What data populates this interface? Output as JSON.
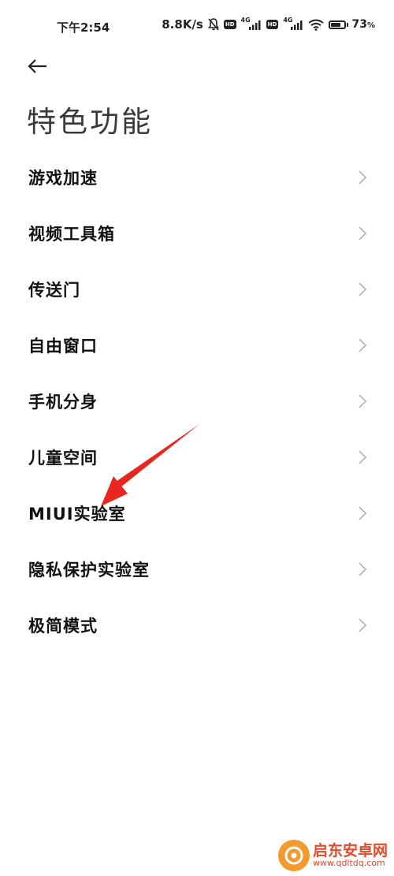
{
  "status_bar": {
    "time": "下午2:54",
    "net_speed": "8.8K/s",
    "sim1_network": "4G",
    "sim2_network": "4G",
    "hd_badge": "HD",
    "battery_percent_value": "73",
    "battery_percent_unit": "%",
    "battery_level": 0.73,
    "icons": [
      "mute-bell-icon",
      "hd-icon",
      "signal-icon",
      "hd-icon",
      "signal-icon",
      "wifi-icon",
      "battery-icon"
    ]
  },
  "header": {
    "back_icon": "back-arrow-icon",
    "title": "特色功能"
  },
  "menu": {
    "items": [
      {
        "label": "游戏加速"
      },
      {
        "label": "视频工具箱"
      },
      {
        "label": "传送门"
      },
      {
        "label": "自由窗口"
      },
      {
        "label": "手机分身"
      },
      {
        "label": "儿童空间"
      },
      {
        "label": "MIUI实验室"
      },
      {
        "label": "隐私保护实验室"
      },
      {
        "label": "极简模式"
      }
    ],
    "chevron_icon": "chevron-right-icon"
  },
  "annotation": {
    "type": "red-arrow",
    "color": "#e8261f",
    "target_item": "MIUI实验室"
  },
  "watermark": {
    "name": "启东安卓网",
    "url": "www.qdltdq.com",
    "color": "#e24a2b"
  }
}
